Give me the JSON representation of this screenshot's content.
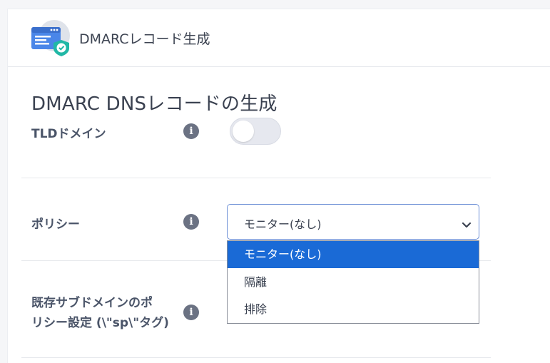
{
  "header": {
    "title": "DMARCレコード生成",
    "icon": "dmarc-record-icon"
  },
  "section": {
    "title": "DMARC DNSレコードの生成"
  },
  "tld": {
    "label": "TLDドメイン",
    "enabled": false
  },
  "policy": {
    "label": "ポリシー",
    "selected": "モニター(なし)",
    "options": [
      "モニター(なし)",
      "隔離",
      "排除"
    ]
  },
  "subdomain_policy": {
    "label_line1": "既存サブドメインのポ",
    "label_line2": "リシー設定 (\\\"sp\\\"タグ)"
  },
  "info_glyph": "i",
  "colors": {
    "accent": "#1a6ad6",
    "shield": "#21b8a6",
    "icon_blue": "#4a86e8"
  }
}
